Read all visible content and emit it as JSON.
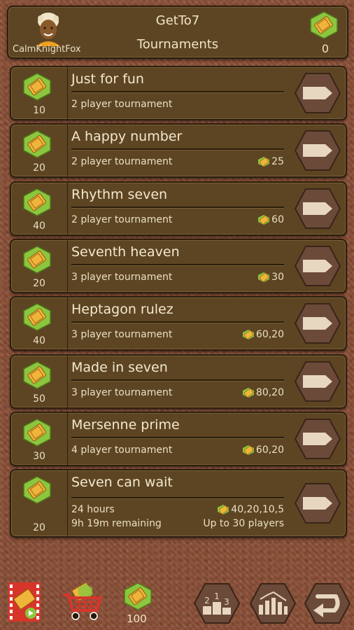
{
  "header": {
    "username": "CalmKnightFox",
    "app_title": "GetTo7",
    "subtitle": "Tournaments",
    "ticket_count": "0"
  },
  "tournaments": [
    {
      "cost": "10",
      "title": "Just for fun",
      "line1": "2 player tournament",
      "prize": "",
      "line2": "",
      "extra": ""
    },
    {
      "cost": "20",
      "title": "A happy number",
      "line1": "2 player tournament",
      "prize": "25",
      "line2": "",
      "extra": ""
    },
    {
      "cost": "40",
      "title": "Rhythm seven",
      "line1": "2 player tournament",
      "prize": "60",
      "line2": "",
      "extra": ""
    },
    {
      "cost": "20",
      "title": "Seventh heaven",
      "line1": "3 player tournament",
      "prize": "30",
      "line2": "",
      "extra": ""
    },
    {
      "cost": "40",
      "title": "Heptagon rulez",
      "line1": "3 player tournament",
      "prize": "60,20",
      "line2": "",
      "extra": ""
    },
    {
      "cost": "50",
      "title": "Made in seven",
      "line1": "3 player tournament",
      "prize": "80,20",
      "line2": "",
      "extra": ""
    },
    {
      "cost": "30",
      "title": "Mersenne prime",
      "line1": "4 player tournament",
      "prize": "60,20",
      "line2": "",
      "extra": ""
    },
    {
      "cost": "20",
      "title": "Seven can wait",
      "line1": "24 hours",
      "prize": "40,20,10,5",
      "line2": "9h 19m remaining",
      "extra": "Up to 30 players"
    }
  ],
  "bottom": {
    "ticket_balance": "100"
  },
  "icons": {
    "ticket": "ticket-icon",
    "arrow": "play-arrow-icon",
    "video": "video-reward-icon",
    "shop": "shop-cart-icon",
    "ranking": "podium-icon",
    "stats": "stats-icon",
    "back": "back-icon"
  },
  "colors": {
    "panel": "#5d4523",
    "button": "#6b4a3a",
    "ticket_orange": "#f0b43a",
    "ticket_green": "#8cc63e"
  }
}
